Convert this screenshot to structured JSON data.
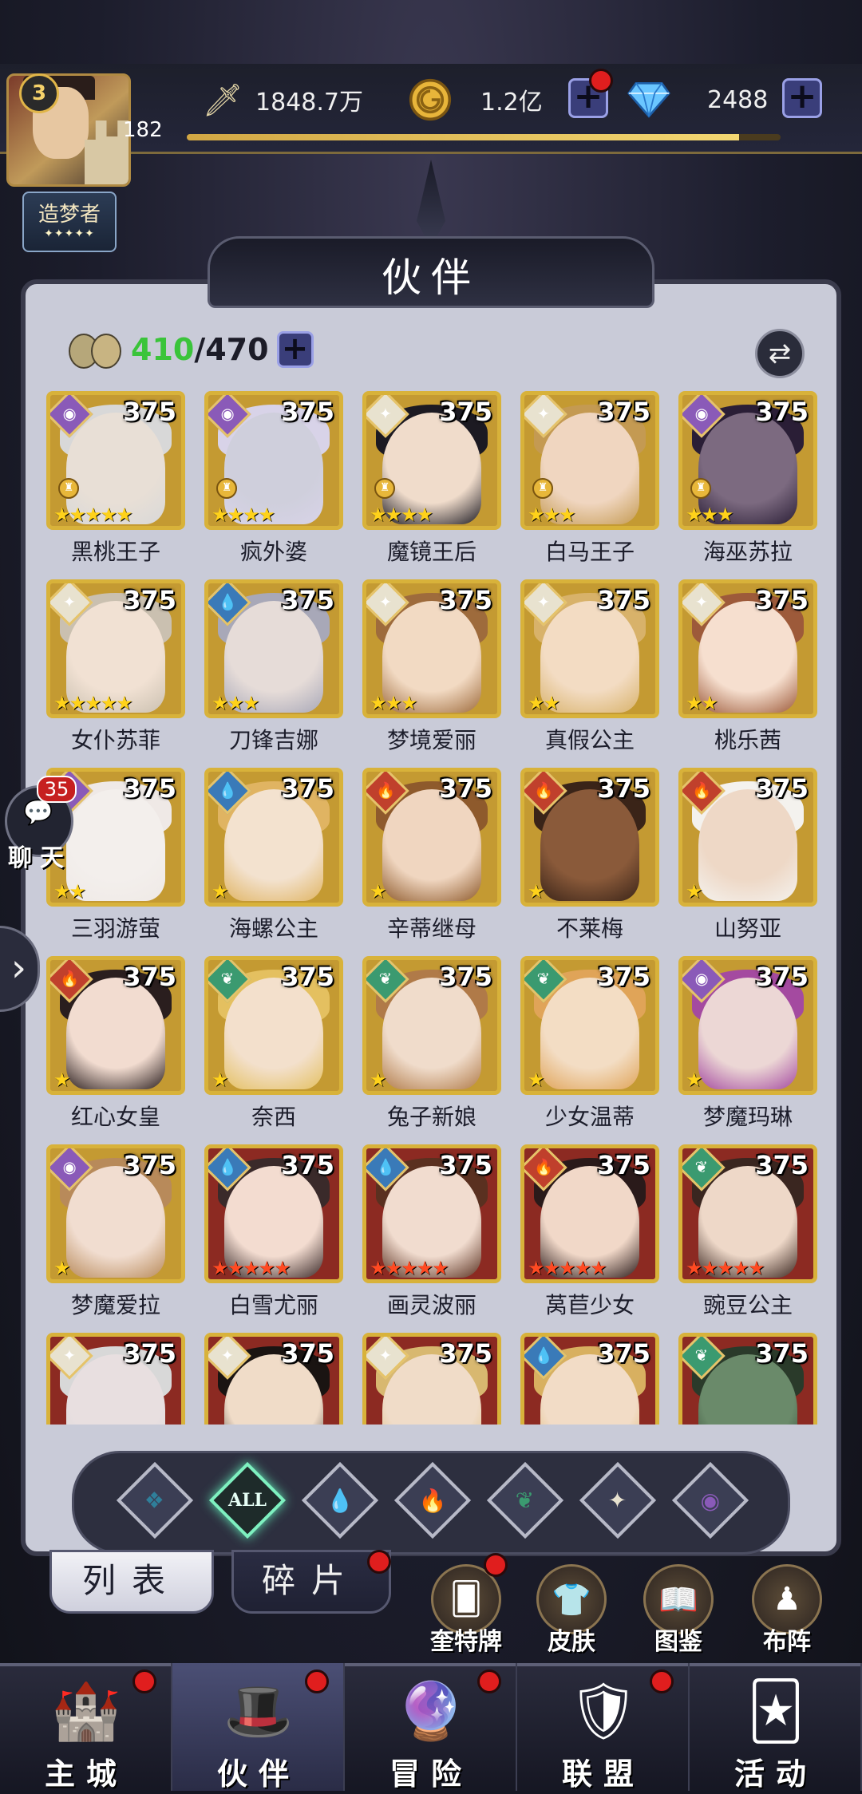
{
  "player": {
    "level": "3",
    "vip": "182",
    "title": "造梦者",
    "title_stars": "✦✦✦✦✦",
    "exp_fraction": 0.93
  },
  "resources": {
    "power": "1848.7万",
    "gold": "1.2亿",
    "gems": "2488"
  },
  "panel": {
    "title": "伙伴",
    "count_current": "410",
    "count_max": "/470"
  },
  "chat": {
    "count": "35",
    "label": "聊天"
  },
  "partners": [
    {
      "name": "黑桃王子",
      "level": "375",
      "element": "shadow",
      "stars": 5,
      "crown": true,
      "frame": "gold",
      "star_color": "gold",
      "skin": "#e8dfd6",
      "hair": "#d8d8d8"
    },
    {
      "name": "疯外婆",
      "level": "375",
      "element": "shadow",
      "stars": 4,
      "crown": true,
      "frame": "gold",
      "star_color": "gold",
      "skin": "#cfcfdc",
      "hair": "#d8d3e8"
    },
    {
      "name": "魔镜王后",
      "level": "375",
      "element": "light",
      "stars": 4,
      "crown": true,
      "frame": "gold",
      "star_color": "gold",
      "skin": "#f0dccb",
      "hair": "#1c1a22"
    },
    {
      "name": "白马王子",
      "level": "375",
      "element": "light",
      "stars": 3,
      "crown": true,
      "frame": "gold",
      "star_color": "gold",
      "skin": "#f0d6c0",
      "hair": "#c49a52"
    },
    {
      "name": "海巫苏拉",
      "level": "375",
      "element": "shadow",
      "stars": 3,
      "crown": true,
      "frame": "gold",
      "star_color": "gold",
      "skin": "#7c6a80",
      "hair": "#2a1e36"
    },
    {
      "name": "女仆苏菲",
      "level": "375",
      "element": "light",
      "stars": 5,
      "crown": false,
      "frame": "gold",
      "star_color": "gold",
      "skin": "#f1e1d3",
      "hair": "#cac0b0"
    },
    {
      "name": "刀锋吉娜",
      "level": "375",
      "element": "water",
      "stars": 3,
      "crown": false,
      "frame": "gold",
      "star_color": "gold",
      "skin": "#e6dcd8",
      "hair": "#a8a8b8"
    },
    {
      "name": "梦境爱丽",
      "level": "375",
      "element": "light",
      "stars": 3,
      "crown": false,
      "frame": "gold",
      "star_color": "gold",
      "skin": "#f2dac3",
      "hair": "#9e6b3c"
    },
    {
      "name": "真假公主",
      "level": "375",
      "element": "light",
      "stars": 2,
      "crown": false,
      "frame": "gold",
      "star_color": "gold",
      "skin": "#f3dcc3",
      "hair": "#d8b26a"
    },
    {
      "name": "桃乐茜",
      "level": "375",
      "element": "light",
      "stars": 2,
      "crown": false,
      "frame": "gold",
      "star_color": "gold",
      "skin": "#f6dfcf",
      "hair": "#9d5a3a"
    },
    {
      "name": "三羽游萤",
      "level": "375",
      "element": "shadow",
      "stars": 2,
      "crown": false,
      "frame": "gold",
      "star_color": "gold",
      "skin": "#f3efec",
      "hair": "#efe9e6"
    },
    {
      "name": "海螺公主",
      "level": "375",
      "element": "water",
      "stars": 1,
      "crown": false,
      "frame": "gold",
      "star_color": "gold",
      "skin": "#f3e2cf",
      "hair": "#e0b462"
    },
    {
      "name": "辛蒂继母",
      "level": "375",
      "element": "fire",
      "stars": 1,
      "crown": false,
      "frame": "gold",
      "star_color": "gold",
      "skin": "#f0d6c0",
      "hair": "#8e5a2c"
    },
    {
      "name": "不莱梅",
      "level": "375",
      "element": "fire",
      "stars": 1,
      "crown": false,
      "frame": "gold",
      "star_color": "gold",
      "skin": "#8a5a3a",
      "hair": "#3a2418"
    },
    {
      "name": "山努亚",
      "level": "375",
      "element": "fire",
      "stars": 1,
      "crown": false,
      "frame": "gold",
      "star_color": "gold",
      "skin": "#eed8c6",
      "hair": "#f4f2ee"
    },
    {
      "name": "红心女皇",
      "level": "375",
      "element": "fire",
      "stars": 1,
      "crown": false,
      "frame": "gold",
      "star_color": "gold",
      "skin": "#f2dcd0",
      "hair": "#2a1e1e"
    },
    {
      "name": "奈西",
      "level": "375",
      "element": "wind",
      "stars": 1,
      "crown": false,
      "frame": "gold",
      "star_color": "gold",
      "skin": "#f3e0cc",
      "hair": "#e4c060"
    },
    {
      "name": "兔子新娘",
      "level": "375",
      "element": "wind",
      "stars": 1,
      "crown": false,
      "frame": "gold",
      "star_color": "gold",
      "skin": "#f0dccb",
      "hair": "#b07a48"
    },
    {
      "name": "少女温蒂",
      "level": "375",
      "element": "wind",
      "stars": 1,
      "crown": false,
      "frame": "gold",
      "star_color": "gold",
      "skin": "#f3ddc4",
      "hair": "#e0a458"
    },
    {
      "name": "梦魔玛琳",
      "level": "375",
      "element": "shadow",
      "stars": 1,
      "crown": false,
      "frame": "gold",
      "star_color": "gold",
      "skin": "#ecd7d5",
      "hair": "#a44aa0"
    },
    {
      "name": "梦魔爱拉",
      "level": "375",
      "element": "shadow",
      "stars": 1,
      "crown": false,
      "frame": "gold",
      "star_color": "gold",
      "skin": "#f1ddd0",
      "hair": "#b88a5a"
    },
    {
      "name": "白雪尤丽",
      "level": "375",
      "element": "water",
      "stars": 5,
      "crown": false,
      "frame": "red",
      "star_color": "red",
      "skin": "#f3dcd0",
      "hair": "#3a2a2a"
    },
    {
      "name": "画灵波丽",
      "level": "375",
      "element": "water",
      "stars": 5,
      "crown": false,
      "frame": "red",
      "star_color": "red",
      "skin": "#f1dccf",
      "hair": "#5a3020"
    },
    {
      "name": "莴苣少女",
      "level": "375",
      "element": "fire",
      "stars": 5,
      "crown": false,
      "frame": "red",
      "star_color": "red",
      "skin": "#f1d8c8",
      "hair": "#2a1a1a"
    },
    {
      "name": "豌豆公主",
      "level": "375",
      "element": "wind",
      "stars": 5,
      "crown": false,
      "frame": "red",
      "star_color": "red",
      "skin": "#eed8c8",
      "hair": "#3a2620"
    },
    {
      "name": "",
      "level": "375",
      "element": "light",
      "stars": 0,
      "crown": false,
      "frame": "red",
      "star_color": "red",
      "skin": "#e8dfe0",
      "hair": "#d8d8d8"
    },
    {
      "name": "",
      "level": "375",
      "element": "light",
      "stars": 0,
      "crown": false,
      "frame": "red",
      "star_color": "red",
      "skin": "#f0dcc8",
      "hair": "#1a1412"
    },
    {
      "name": "",
      "level": "375",
      "element": "light",
      "stars": 0,
      "crown": false,
      "frame": "red",
      "star_color": "red",
      "skin": "#f0dcc8",
      "hair": "#d8b870"
    },
    {
      "name": "",
      "level": "375",
      "element": "water",
      "stars": 0,
      "crown": false,
      "frame": "red",
      "star_color": "red",
      "skin": "#f2dcc6",
      "hair": "#d8b060"
    },
    {
      "name": "",
      "level": "375",
      "element": "wind",
      "stars": 0,
      "crown": false,
      "frame": "red",
      "star_color": "red",
      "skin": "#6a8a6a",
      "hair": "#2a3a2a"
    }
  ],
  "filters": [
    {
      "id": "wind-dark",
      "label": "",
      "icon": "wing-icon"
    },
    {
      "id": "all",
      "label": "ALL",
      "icon": ""
    },
    {
      "id": "water",
      "label": "",
      "icon": "water-drop-icon"
    },
    {
      "id": "fire",
      "label": "",
      "icon": "flame-icon"
    },
    {
      "id": "wind",
      "label": "",
      "icon": "leaf-icon"
    },
    {
      "id": "light",
      "label": "",
      "icon": "star-icon"
    },
    {
      "id": "shadow",
      "label": "",
      "icon": "eye-icon"
    }
  ],
  "tabs": {
    "list": "列表",
    "fragments": "碎片"
  },
  "quick_actions": [
    {
      "label": "奎特牌",
      "icon": "card-pack-icon",
      "dot": true
    },
    {
      "label": "皮肤",
      "icon": "skin-icon",
      "dot": false
    },
    {
      "label": "图鉴",
      "icon": "book-icon",
      "dot": false
    },
    {
      "label": "布阵",
      "icon": "formation-icon",
      "dot": false
    }
  ],
  "nav": [
    {
      "label": "主城",
      "icon": "castle-icon",
      "dot": true
    },
    {
      "label": "伙伴",
      "icon": "witch-hat-icon",
      "dot": true
    },
    {
      "label": "冒险",
      "icon": "compass-orb-icon",
      "dot": true
    },
    {
      "label": "联盟",
      "icon": "shield-icon",
      "dot": true
    },
    {
      "label": "活动",
      "icon": "cards-icon",
      "dot": false
    }
  ],
  "colors": {
    "element_water": "#3a7ab8",
    "element_fire": "#c0402c",
    "element_wind": "#3b9a70",
    "element_light": "#e8e2cf",
    "element_shadow": "#8a5ab8",
    "star_gold": "#ffd21a",
    "star_red": "#ff4a22",
    "count_green": "#3ac43a"
  }
}
